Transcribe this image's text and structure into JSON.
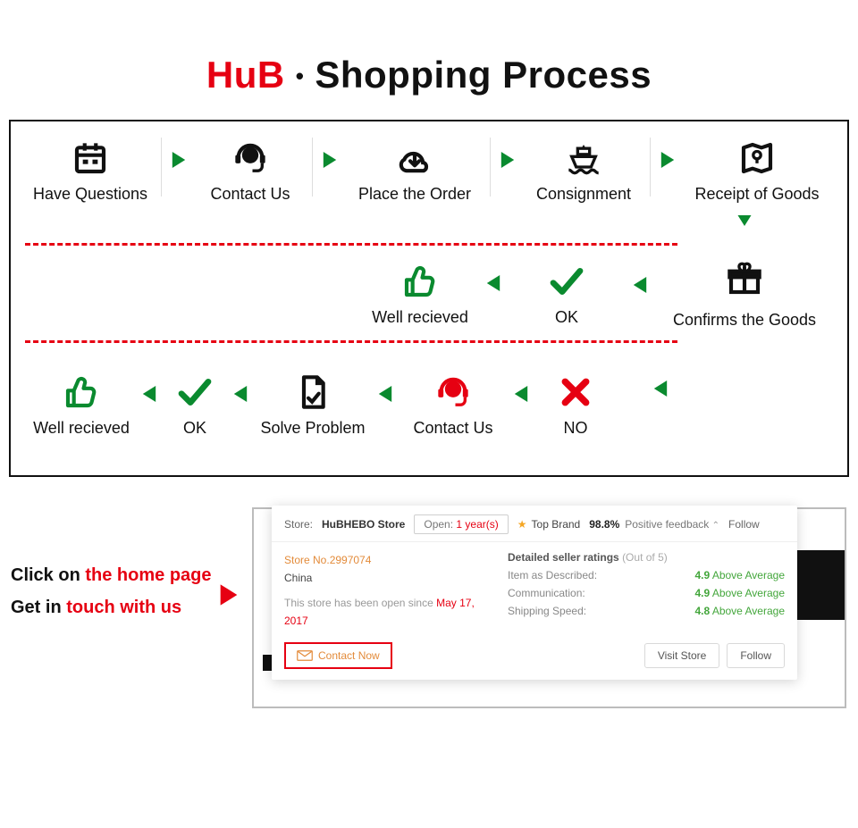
{
  "title": {
    "brand": "HuB",
    "rest": "Shopping Process"
  },
  "row1": {
    "s1": "Have Questions",
    "s2": "Contact Us",
    "s3": "Place the Order",
    "s4": "Consignment",
    "s5": "Receipt of Goods"
  },
  "row2": {
    "s1": "Well recieved",
    "s2": "OK"
  },
  "confirms": "Confirms the Goods",
  "row3": {
    "s1": "Well recieved",
    "s2": "OK",
    "s3": "Solve Problem",
    "s4": "Contact Us",
    "s5": "NO"
  },
  "instr": {
    "l1a": "Click on ",
    "l1b": "the home page",
    "l2a": "Get in ",
    "l2b": "touch with us"
  },
  "store": {
    "label": "Store:",
    "name": "HuBHEBO Store",
    "open_label": "Open:",
    "open_years": "1 year(s)",
    "topbrand": "Top Brand",
    "pf_pct": "98.8%",
    "pf_label": "Positive feedback",
    "follow": "Follow",
    "store_no": "Store No.2997074",
    "country": "China",
    "opened_pre": "This store has been open since ",
    "opened_date": "May 17, 2017",
    "ratings_hd": "Detailed seller ratings",
    "ratings_of": "(Out of 5)",
    "r1l": "Item as Described:",
    "r1v": "4.9",
    "r1t": "Above Average",
    "r2l": "Communication:",
    "r2v": "4.9",
    "r2t": "Above Average",
    "r3l": "Shipping Speed:",
    "r3v": "4.8",
    "r3t": "Above Average",
    "contact": "Contact Now",
    "visit": "Visit Store",
    "follow2": "Follow"
  }
}
